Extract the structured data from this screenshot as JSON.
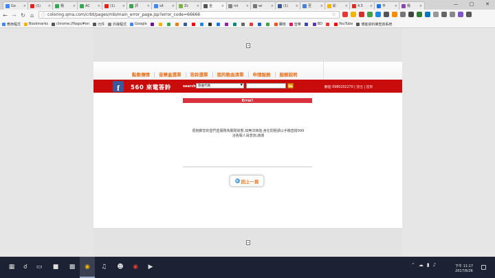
{
  "browser": {
    "tabs": [
      {
        "label": "Go",
        "color": "#4285f4"
      },
      {
        "label": "(1)",
        "color": "#e62117"
      },
      {
        "label": "我",
        "color": "#34a853"
      },
      {
        "label": "AC",
        "color": "#34a853"
      },
      {
        "label": "(1)",
        "color": "#e62117"
      },
      {
        "label": "評",
        "color": "#3fa34d"
      },
      {
        "label": "sit",
        "color": "#4285f4"
      },
      {
        "label": "Zc",
        "color": "#7cb342"
      },
      {
        "label": "全",
        "color": "#555555",
        "active": true
      },
      {
        "label": "ml",
        "color": "#888888"
      },
      {
        "label": "wi",
        "color": "#777777"
      },
      {
        "label": "(1)",
        "color": "#3b5998"
      },
      {
        "label": "至",
        "color": "#4a7fd8"
      },
      {
        "label": "彩",
        "color": "#f4b400"
      },
      {
        "label": "4.5",
        "color": "#d93025"
      },
      {
        "label": "平",
        "color": "#1a73e8"
      },
      {
        "label": "我",
        "color": "#8e44ad"
      }
    ],
    "address": "coloring.qma.com/crbt/pages/mb/main_error_page.jsp?error_code=66666",
    "bookmarks": [
      {
        "label": "應用程式",
        "color": "#4285f4"
      },
      {
        "label": "Bookmarks",
        "color": "#f4b400"
      },
      {
        "label": "chrome://flags/#en",
        "color": "#555555"
      },
      {
        "label": "元件",
        "color": "#555555"
      },
      {
        "label": "外接程式",
        "color": "#888888"
      },
      {
        "label": "Google",
        "color": "#4285f4"
      },
      {
        "label": "",
        "color": "#720e9e"
      },
      {
        "label": "",
        "color": "#f4b400"
      },
      {
        "label": "",
        "color": "#34a853"
      },
      {
        "label": "",
        "color": "#e67e22"
      },
      {
        "label": "",
        "color": "#3b5998"
      },
      {
        "label": "",
        "color": "#ff0000"
      },
      {
        "label": "",
        "color": "#1e88e5"
      },
      {
        "label": "",
        "color": "#333333"
      },
      {
        "label": "",
        "color": "#1a73e8"
      },
      {
        "label": "",
        "color": "#8e24aa"
      },
      {
        "label": "",
        "color": "#00897b"
      },
      {
        "label": "",
        "color": "#666666"
      },
      {
        "label": "",
        "color": "#e53935"
      },
      {
        "label": "",
        "color": "#1565c0"
      },
      {
        "label": "",
        "color": "#43a047"
      },
      {
        "label": "購物",
        "color": "#f4511e"
      },
      {
        "label": "音樂",
        "color": "#d81b60"
      },
      {
        "label": "",
        "color": "#3949ab"
      },
      {
        "label": "BD",
        "color": "#5e35b1"
      },
      {
        "label": "",
        "color": "#e53935"
      },
      {
        "label": "YouTube",
        "color": "#ff0000"
      },
      {
        "label": "博客資料庫查詢系統",
        "color": "#555555"
      }
    ]
  },
  "site": {
    "menu": [
      "點歌傳情",
      "音樂盒選單",
      "答鈴選單",
      "我的歌曲清單",
      "申請服務",
      "服務說明"
    ],
    "fb_letter": "f",
    "brand": "560 來電答鈴",
    "search_label": "search",
    "search_select": "歌曲代碼",
    "go_label": "Go",
    "welcome": "歡迎 0980202270",
    "logout": "登出",
    "home": "首頁",
    "error_title": "Error!",
    "error_line1": "很抱歉您的登門盒服務為關閉狀態,如無法節能,身在問題請以手機直撥999",
    "error_line2": "洽各服人員查詢,謝謝",
    "back_label": "回上一頁"
  },
  "taskbar": {
    "time": "下午 11:17",
    "date": "2017/6/26"
  }
}
